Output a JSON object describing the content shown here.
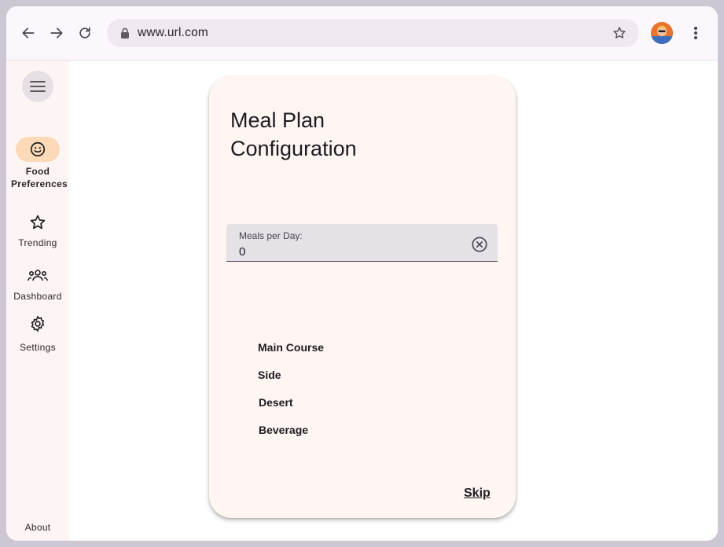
{
  "browser": {
    "url": "www.url.com",
    "icons": {
      "back": "arrow-back-icon",
      "forward": "arrow-forward-icon",
      "reload": "reload-icon",
      "lock": "lock-icon",
      "bookmark": "star-outline-icon",
      "menu": "more-vert-icon"
    }
  },
  "sidebar": {
    "items": [
      {
        "label": "Food Preferences",
        "icon": "smiley-icon",
        "active": true
      },
      {
        "label": "Trending",
        "icon": "star-outline-icon",
        "active": false
      },
      {
        "label": "Dashboard",
        "icon": "groups-icon",
        "active": false
      },
      {
        "label": "Settings",
        "icon": "gear-icon",
        "active": false
      }
    ],
    "about_label": "About"
  },
  "card": {
    "title": "Meal Plan Configuration",
    "field": {
      "label": "Meals per Day:",
      "value": "0"
    },
    "options": [
      "Main Course",
      "Side",
      "Desert",
      "Beverage"
    ],
    "skip_label": "Skip"
  },
  "colors": {
    "active_pill": "#fcd9b7",
    "card_bg": "#fff5f3",
    "sidebar_bg": "#fdf5f3",
    "field_bg": "#e6e0e7"
  }
}
